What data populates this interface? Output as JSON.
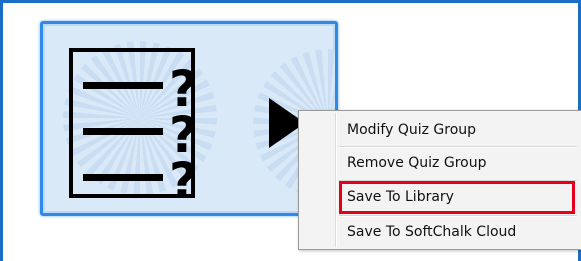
{
  "quiz_group": {
    "icon": "quiz-group-icon",
    "play_icon": "play-arrow-icon"
  },
  "context_menu": {
    "items": [
      {
        "label": "Modify Quiz Group"
      },
      {
        "label": "Remove Quiz Group"
      },
      {
        "label": "Save To Library",
        "highlighted": true
      },
      {
        "label": "Save To SoftChalk Cloud"
      }
    ]
  },
  "colors": {
    "frame_border": "#1a6fc4",
    "button_border": "#2e8ae6",
    "button_fill": "#d9e9f8",
    "menu_background": "#f3f3f3",
    "highlight": "#e3001b"
  }
}
